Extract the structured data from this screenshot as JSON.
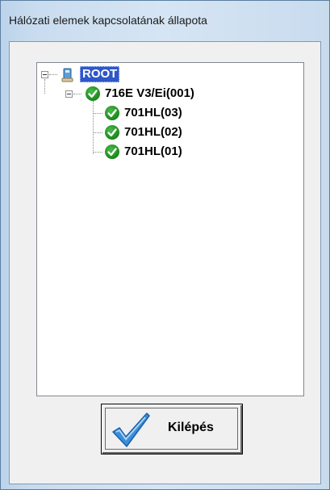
{
  "window": {
    "title": "Hálózati elemek kapcsolatának állapota"
  },
  "tree": {
    "root": {
      "label": "ROOT",
      "icon": "network-root-icon",
      "selected": true,
      "expanded": true
    },
    "device": {
      "label": "716E V3/Ei(001)",
      "icon": "check-ok-icon",
      "expanded": true
    },
    "children": [
      {
        "label": "701HL(03)",
        "icon": "check-ok-icon"
      },
      {
        "label": "701HL(02)",
        "icon": "check-ok-icon"
      },
      {
        "label": "701HL(01)",
        "icon": "check-ok-icon"
      }
    ]
  },
  "exit_button": {
    "label": "Kilépés",
    "icon": "checkmark-icon"
  },
  "colors": {
    "status_ok": "#1f8f1f",
    "selection": "#2e57c9"
  }
}
